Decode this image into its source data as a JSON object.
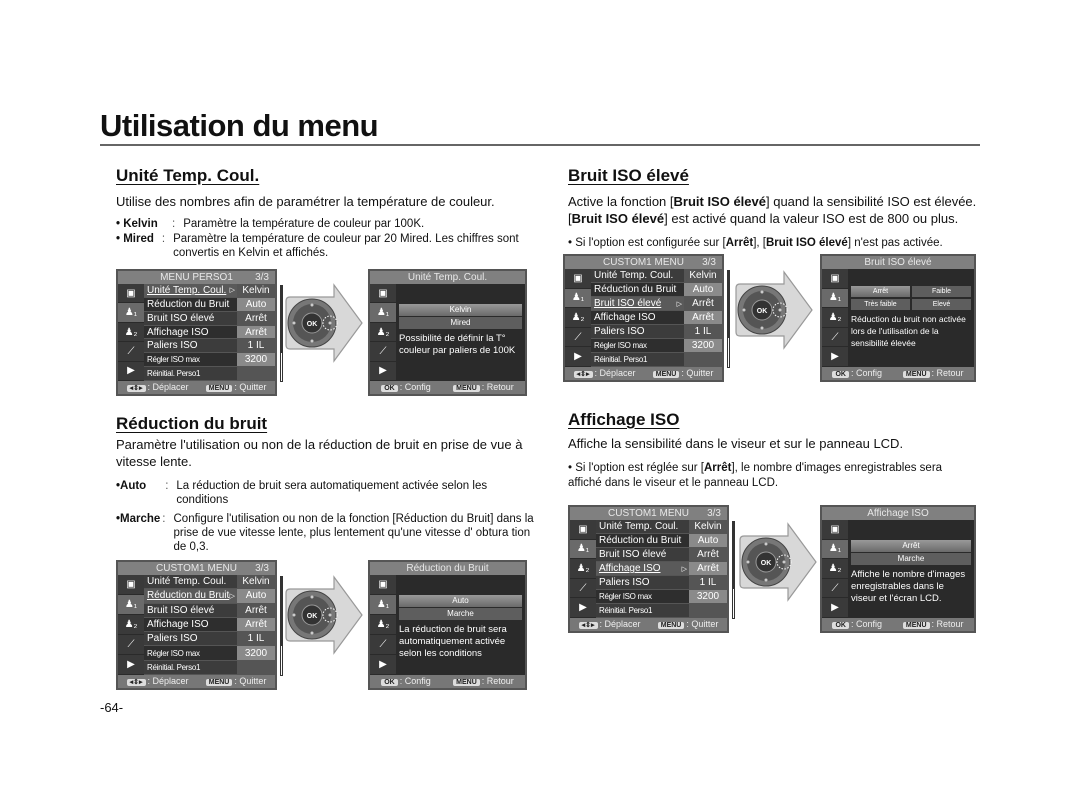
{
  "page": {
    "title": "Utilisation du menu",
    "page_number": "-64-"
  },
  "sections": {
    "unite": {
      "heading": "Unité Temp. Coul.",
      "lead": "Utilise des nombres afin de paramétrer la température de couleur.",
      "bullets": [
        {
          "key": "• Kelvin",
          "text": "Paramètre la température de couleur par 100K."
        },
        {
          "key": "• Mired",
          "text": "Paramètre la température de couleur par 20 Mired. Les chiffres sont convertis  en Kelvin et affichés."
        }
      ]
    },
    "bruit_iso": {
      "heading": "Bruit ISO élevé",
      "lead_parts": [
        "Active la fonction [",
        "Bruit ISO élevé",
        "] quand la sensibilité ISO est élevée. [",
        "Bruit ISO élevé",
        "] est activé quand la valeur ISO est de 800 ou plus."
      ],
      "note_parts": [
        "• Si l'option est configurée sur [",
        "Arrêt",
        "], [",
        "Bruit ISO élevé",
        "] n'est pas activée."
      ]
    },
    "reduction": {
      "heading": "Réduction du bruit",
      "lead": "Paramètre l'utilisation ou non de la réduction de bruit en prise de vue à vitesse lente.",
      "bullets": [
        {
          "key": "•Auto",
          "text": "La réduction de bruit sera automatiquement activée selon les conditions"
        },
        {
          "key": "•Marche",
          "text": "Configure l'utilisation ou non de la fonction [Réduction du Bruit] dans la prise de vue vitesse lente, plus lentement qu'une vitesse d' obtura tion de 0,3."
        }
      ]
    },
    "affichage": {
      "heading": "Affichage ISO",
      "lead": "Affiche la sensibilité dans le viseur et sur le panneau LCD.",
      "note_parts": [
        "•  Si l'option est réglée sur [",
        "Arrêt",
        "], le nombre d'images enregistrables sera affiché dans le viseur et le panneau LCD."
      ]
    }
  },
  "menu_screens": {
    "unite": {
      "header": "MENU PERSO1",
      "page": "3/3",
      "rows": [
        {
          "label": "Unité Temp. Coul.",
          "value": "Kelvin"
        },
        {
          "label": "Réduction du Bruit",
          "value": "Auto"
        },
        {
          "label": "Bruit ISO élevé",
          "value": "Arrêt"
        },
        {
          "label": "Affichage ISO",
          "value": "Arrêt"
        },
        {
          "label": "Paliers ISO",
          "value": "1 IL"
        },
        {
          "label": "Régler ISO max",
          "value": "3200"
        },
        {
          "label": "Réinitial. Perso1",
          "value": ""
        }
      ],
      "selected_row": 0,
      "footer_move_key": "◂⇕▸",
      "footer_move": ": Déplacer",
      "footer_menu_key": "MENU",
      "footer_quit": ": Quitter"
    },
    "bruit_iso": {
      "header": "CUSTOM1 MENU",
      "page": "3/3",
      "rows": [
        {
          "label": "Unité Temp. Coul.",
          "value": "Kelvin"
        },
        {
          "label": "Réduction du Bruit",
          "value": "Auto"
        },
        {
          "label": "Bruit ISO élevé",
          "value": "Arrêt"
        },
        {
          "label": "Affichage ISO",
          "value": "Arrêt"
        },
        {
          "label": "Paliers ISO",
          "value": "1 IL"
        },
        {
          "label": "Régler ISO max",
          "value": "3200"
        },
        {
          "label": "Réinitial. Perso1",
          "value": ""
        }
      ],
      "selected_row": 2,
      "footer_move_key": "◂⇕▸",
      "footer_move": ": Déplacer",
      "footer_menu_key": "MENU",
      "footer_quit": ": Quitter"
    },
    "reduction": {
      "header": "CUSTOM1 MENU",
      "page": "3/3",
      "rows": [
        {
          "label": "Unité Temp. Coul.",
          "value": "Kelvin"
        },
        {
          "label": "Réduction du Bruit",
          "value": "Auto"
        },
        {
          "label": "Bruit ISO élevé",
          "value": "Arrêt"
        },
        {
          "label": "Affichage ISO",
          "value": "Arrêt"
        },
        {
          "label": "Paliers ISO",
          "value": "1 IL"
        },
        {
          "label": "Régler ISO max",
          "value": "3200"
        },
        {
          "label": "Réinitial. Perso1",
          "value": ""
        }
      ],
      "selected_row": 1,
      "footer_move_key": "◂⇕▸",
      "footer_move": ": Déplacer",
      "footer_menu_key": "MENU",
      "footer_quit": ": Quitter"
    },
    "affichage": {
      "header": "CUSTOM1 MENU",
      "page": "3/3",
      "rows": [
        {
          "label": "Unité Temp. Coul.",
          "value": "Kelvin"
        },
        {
          "label": "Réduction du Bruit",
          "value": "Auto"
        },
        {
          "label": "Bruit ISO élevé",
          "value": "Arrêt"
        },
        {
          "label": "Affichage ISO",
          "value": "Arrêt"
        },
        {
          "label": "Paliers ISO",
          "value": "1 IL"
        },
        {
          "label": "Régler ISO max",
          "value": "3200"
        },
        {
          "label": "Réinitial. Perso1",
          "value": ""
        }
      ],
      "selected_row": 3,
      "footer_move_key": "◂⇕▸",
      "footer_move": ": Déplacer",
      "footer_menu_key": "MENU",
      "footer_quit": ": Quitter"
    }
  },
  "detail_screens": {
    "unite": {
      "header": "Unité Temp. Coul.",
      "options": [
        "Kelvin",
        "Mired"
      ],
      "description": "Possibilité de définir la T° couleur par paliers de 100K",
      "footer_ok_key": "OK",
      "footer_config": ": Config",
      "footer_menu_key": "MENU",
      "footer_back": ": Retour"
    },
    "bruit_iso": {
      "header": "Bruit ISO élevé",
      "options": [
        "Arrêt",
        "Faible",
        "Très faible",
        "Elevé"
      ],
      "description": "Réduction du bruit non activée lors de l'utilisation de la sensibilité élevée",
      "footer_ok_key": "OK",
      "footer_config": ": Config",
      "footer_menu_key": "MENU",
      "footer_back": ": Retour"
    },
    "reduction": {
      "header": "Réduction du Bruit",
      "options": [
        "Auto",
        "Marche"
      ],
      "description": "La réduction de bruit sera automatiquement activée selon les conditions",
      "footer_ok_key": "OK",
      "footer_config": ": Config",
      "footer_menu_key": "MENU",
      "footer_back": ": Retour"
    },
    "affichage": {
      "header": "Affichage ISO",
      "options": [
        "Arrêt",
        "Marche"
      ],
      "description": "Affiche le nombre d'images enregistrables dans le viseur et l'écran LCD.",
      "footer_ok_key": "OK",
      "footer_config": ": Config",
      "footer_menu_key": "MENU",
      "footer_back": ": Retour"
    }
  },
  "icons": {
    "tabs": [
      "camera-icon",
      "custom1-icon",
      "custom2-icon",
      "wrench-icon",
      "play-icon"
    ],
    "dial_label": "OK"
  }
}
